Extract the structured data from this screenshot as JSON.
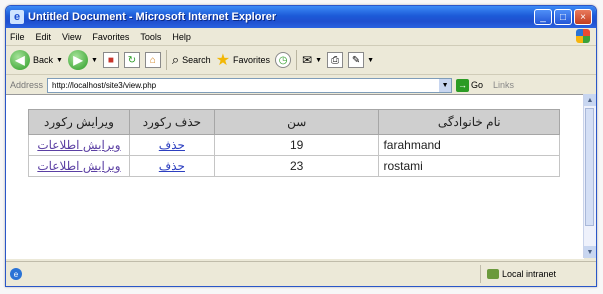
{
  "window": {
    "title": "Untitled Document - Microsoft Internet Explorer",
    "buttons": {
      "minimize": "_",
      "maximize": "□",
      "close": "×"
    }
  },
  "menu": [
    "File",
    "Edit",
    "View",
    "Favorites",
    "Tools",
    "Help"
  ],
  "toolbar": {
    "back": "Back",
    "search": "Search",
    "favorites": "Favorites"
  },
  "address": {
    "label": "Address",
    "url": "http://localhost/site3/view.php",
    "go": "Go",
    "links": "Links"
  },
  "table": {
    "headers": [
      "نام خانوادگی",
      "سن",
      "حذف رکورد",
      "ویرایش رکورد"
    ],
    "rows": [
      {
        "lastname": "farahmand",
        "age": "19",
        "delete": "حذف",
        "edit": "ویرایش اطلاعات"
      },
      {
        "lastname": "rostami",
        "age": "23",
        "delete": "حذف",
        "edit": "ویرایش اطلاعات"
      }
    ]
  },
  "status": {
    "zone": "Local intranet"
  },
  "icons": {
    "app": "ie-logo-icon",
    "back": "back-arrow-icon",
    "forward": "forward-arrow-icon",
    "stop": "stop-icon",
    "refresh": "refresh-icon",
    "home": "home-icon",
    "search": "search-icon",
    "favorites": "star-icon",
    "history": "history-icon",
    "mail": "mail-icon",
    "print": "print-icon",
    "edit": "edit-icon",
    "zone": "intranet-icon"
  }
}
